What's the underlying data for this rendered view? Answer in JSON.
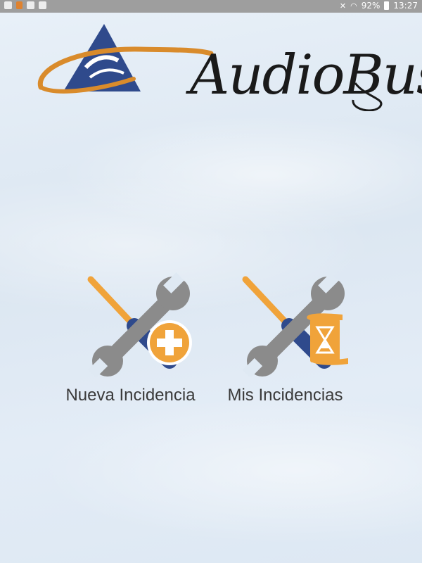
{
  "status_bar": {
    "battery": "92%",
    "time": "13:27"
  },
  "logo": {
    "text": "AudioBus"
  },
  "actions": [
    {
      "label": "Nueva Incidencia",
      "badge_icon": "plus-icon"
    },
    {
      "label": "Mis Incidencias",
      "badge_icon": "hourglass-scroll-icon"
    }
  ],
  "colors": {
    "orange": "#f0a33a",
    "blue": "#2f4a8c",
    "gray": "#8b8b8b",
    "status_bar": "#9e9e9e"
  }
}
